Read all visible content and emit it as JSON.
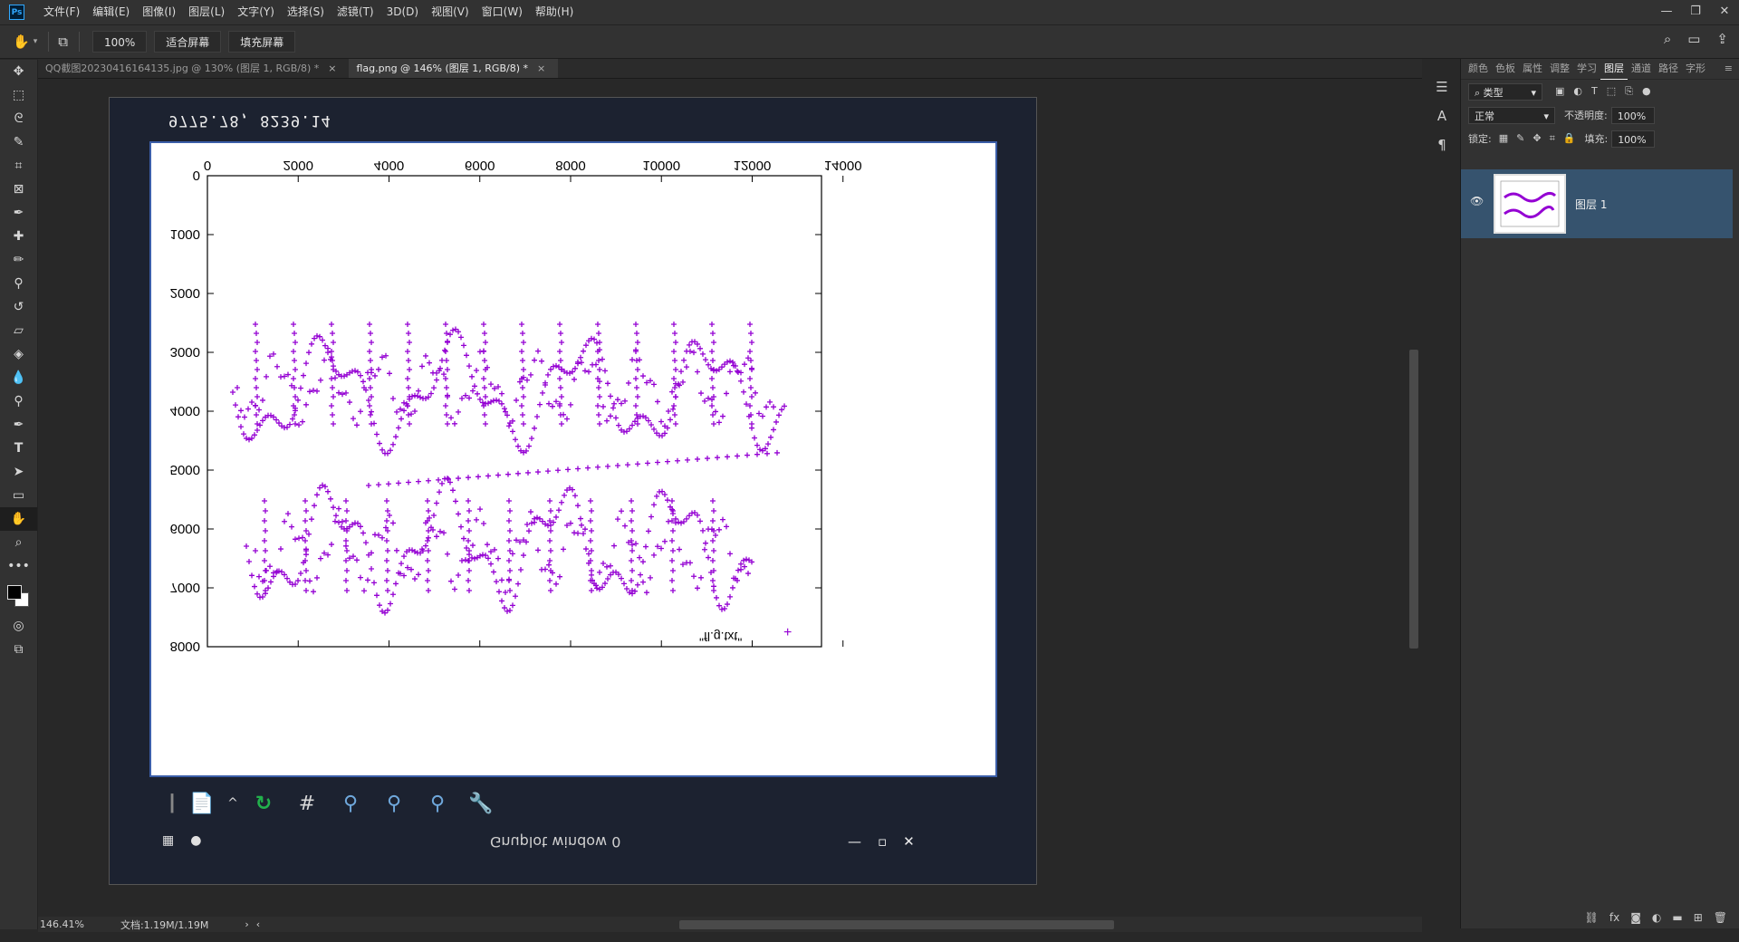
{
  "menu": {
    "items": [
      "文件(F)",
      "编辑(E)",
      "图像(I)",
      "图层(L)",
      "文字(Y)",
      "选择(S)",
      "滤镜(T)",
      "3D(D)",
      "视图(V)",
      "窗口(W)",
      "帮助(H)"
    ],
    "app_icon": "Ps"
  },
  "options": {
    "zoom": "100%",
    "fit_screen": "适合屏幕",
    "fill_screen": "填充屏幕"
  },
  "tabs": [
    {
      "label": "QQ截图20230416164135.jpg @ 130% (图层 1, RGB/8) *",
      "close": "×"
    },
    {
      "label": "flag.png @ 146% (图层 1, RGB/8) *",
      "close": "×"
    }
  ],
  "canvas": {
    "coord_readout": "9775.78, 8239.14",
    "gnuplot_title": "Gnuplot window 0",
    "legend": "\"fl.g.txt\"",
    "x_ticks": [
      "0",
      "2000",
      "4000",
      "6000",
      "8000",
      "10000",
      "12000",
      "14000"
    ],
    "y_ticks": [
      "0",
      "1000",
      "2000",
      "3000",
      "4000",
      "5000",
      "6000",
      "7000",
      "8000"
    ],
    "plot_color": "#9400d3"
  },
  "layers_panel": {
    "tabs": [
      "颜色",
      "色板",
      "属性",
      "调整",
      "学习",
      "图层",
      "通道",
      "路径",
      "字形"
    ],
    "active_tab": "图层",
    "filter": "类型",
    "blend_mode": "正常",
    "opacity_label": "不透明度:",
    "opacity_value": "100%",
    "lock_label": "锁定:",
    "fill_label": "填充:",
    "fill_value": "100%",
    "layer_name": "图层 1"
  },
  "status": {
    "zoom": "146.41%",
    "doc_info": "文档:1.19M/1.19M"
  }
}
